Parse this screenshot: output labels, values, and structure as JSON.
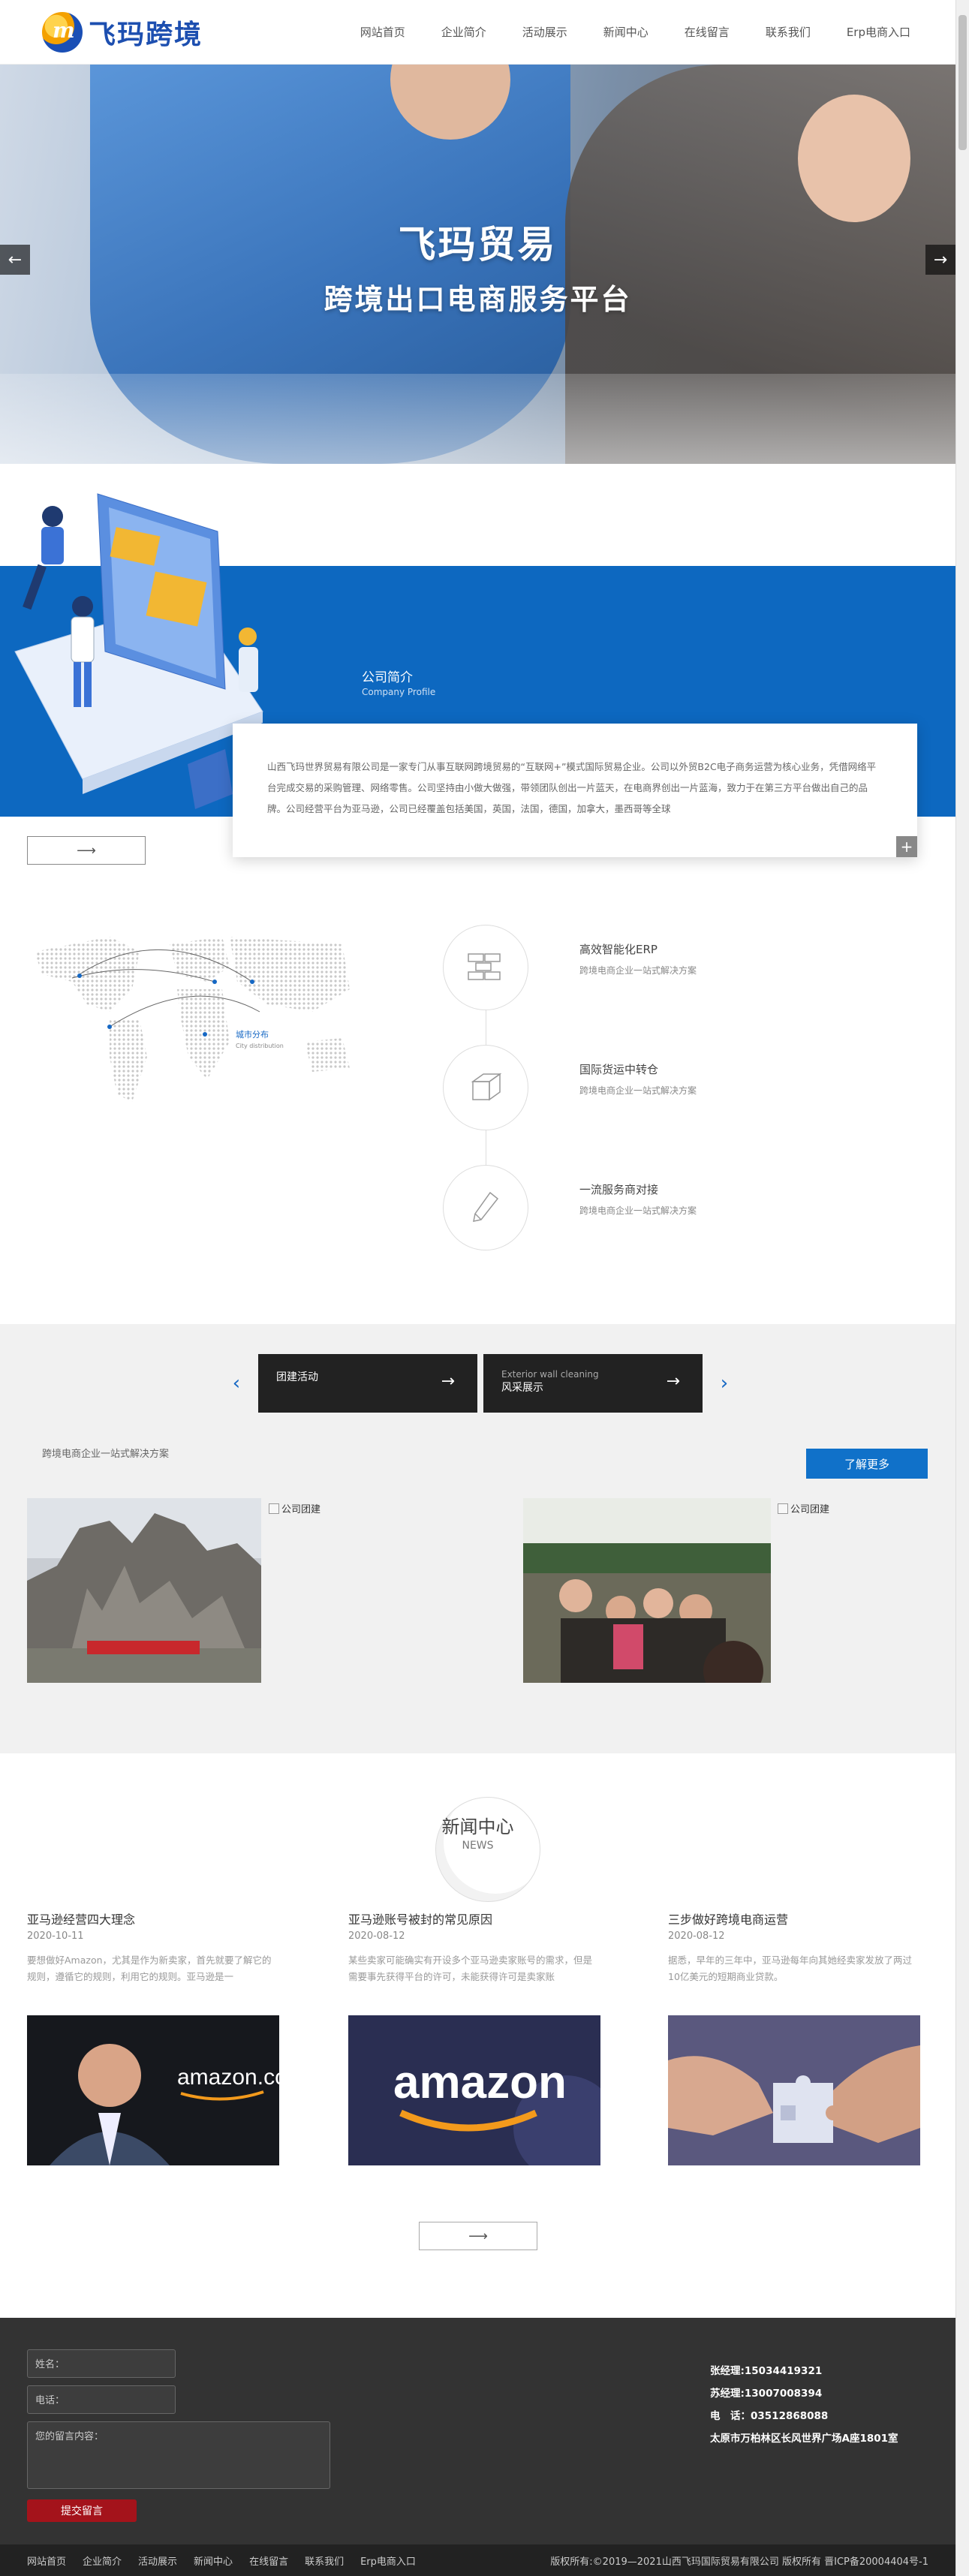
{
  "header": {
    "logo_text": "飞玛跨境",
    "nav": [
      "网站首页",
      "企业简介",
      "活动展示",
      "新闻中心",
      "在线留言",
      "联系我们",
      "Erp电商入口"
    ]
  },
  "banner": {
    "title": "飞玛贸易",
    "subtitle": "跨境出口电商服务平台",
    "prev": "←",
    "next": "→"
  },
  "about": {
    "title": "公司简介",
    "title_en": "Company Profile",
    "text": "山西飞玛世界贸易有限公司是一家专门从事互联网跨境贸易的“互联网+”模式国际贸易企业。公司以外贸B2C电子商务运营为核心业务，凭借网络平台完成交易的采购管理、网络零售。公司坚持由小做大做强，带领团队创出一片蓝天，在电商界创出一片蓝海，致力于在第三方平台做出自己的品牌。公司经营平台为亚马逊，公司已经覆盖包括美国，英国，法国，德国，加拿大，墨西哥等全球",
    "more": "⟶",
    "plus": "+"
  },
  "features": {
    "map_label": "城市分布",
    "map_label_en": "City distribution",
    "items": [
      {
        "title": "高效智能化ERP",
        "desc": "跨境电商企业一站式解决方案",
        "icon": "bricks-icon"
      },
      {
        "title": "国际货运中转仓",
        "desc": "跨境电商企业一站式解决方案",
        "icon": "box-icon"
      },
      {
        "title": "一流服务商对接",
        "desc": "跨境电商企业一站式解决方案",
        "icon": "pen-icon"
      }
    ]
  },
  "cases": {
    "tabs": [
      {
        "label": "团建活动",
        "small": ""
      },
      {
        "label": "风采展示",
        "small": "Exterior wall cleaning"
      }
    ],
    "prev": "‹",
    "next": "›",
    "go": "→",
    "desc": "跨境电商企业一站式解决方案",
    "more": "了解更多",
    "image_alt": [
      "公司团建",
      "公司团建"
    ]
  },
  "news": {
    "title": "新闻中心",
    "title_en": "NEWS",
    "items": [
      {
        "title": "亚马逊经营四大理念",
        "date": "2020-10-11",
        "summary": "要想做好Amazon，尤其是作为新卖家，首先就要了解它的规则，遵循它的规则，利用它的规则。亚马逊是一"
      },
      {
        "title": "亚马逊账号被封的常见原因",
        "date": "2020-08-12",
        "summary": "某些卖家可能确实有开设多个亚马逊卖家账号的需求，但是需要事先获得平台的许可，未能获得许可是卖家账"
      },
      {
        "title": "三步做好跨境电商运营",
        "date": "2020-08-12",
        "summary": "据悉，早年的三年中，亚马逊每年向其她经卖家发放了两过10亿美元的短期商业贷款。"
      }
    ],
    "more": "⟶",
    "amazon_logo": "amazon.com",
    "amazon_logo2": "amazon"
  },
  "footer": {
    "name_placeholder": "姓名：",
    "phone_placeholder": "电话：",
    "message_placeholder": "您的留言内容：",
    "submit": "提交留言",
    "contact": [
      "张经理:15034419321",
      "苏经理:13007008394",
      "电　话：03512868088",
      "太原市万柏林区长风世界广场A座1801室"
    ],
    "bottom_links": [
      "网站首页",
      "企业简介",
      "活动展示",
      "新闻中心",
      "在线留言",
      "联系我们",
      "Erp电商入口"
    ],
    "copyright": "版权所有:©2019—2021山西飞玛国际贸易有限公司  版权所有  晋ICP备20004404号-1"
  }
}
